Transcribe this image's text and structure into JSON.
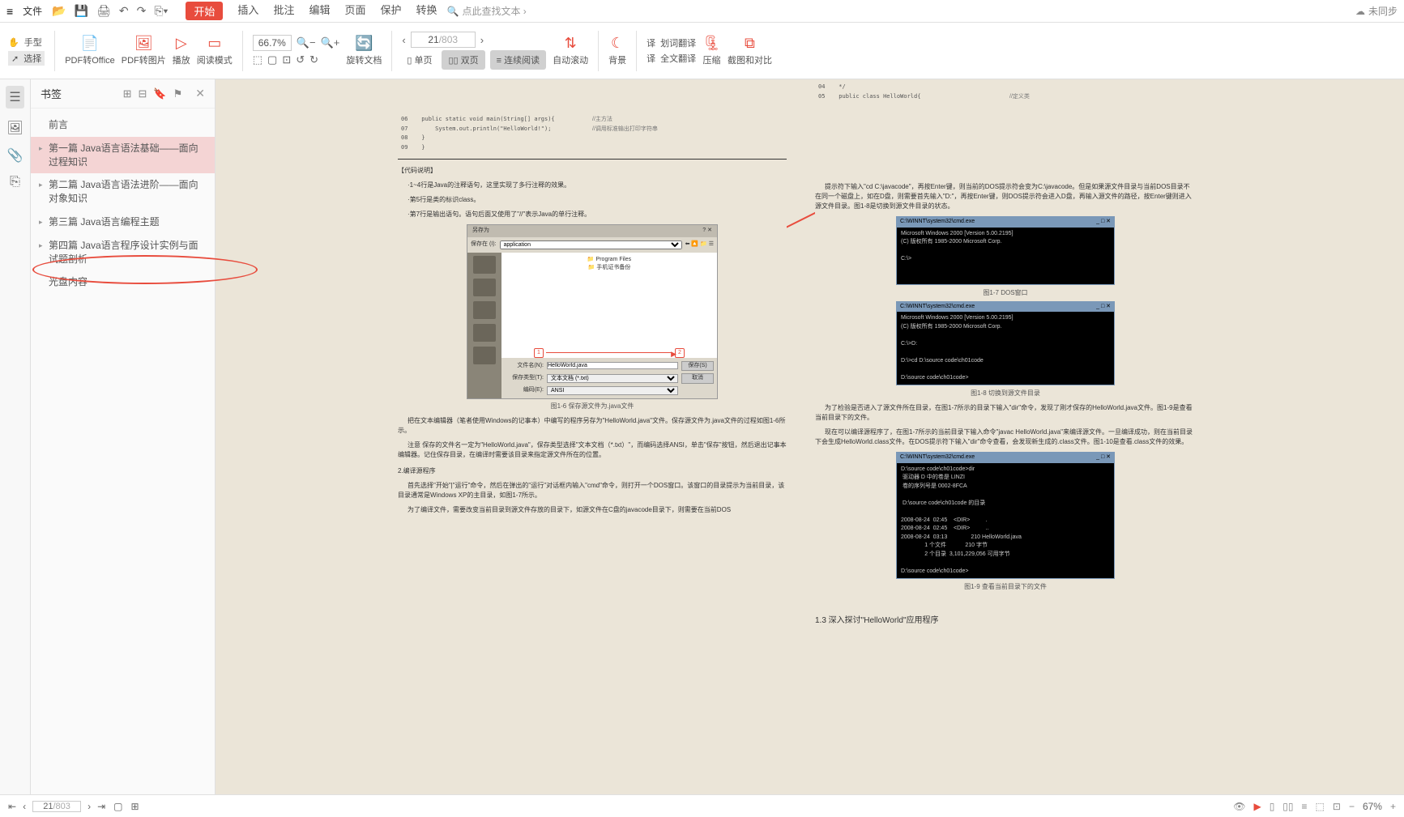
{
  "titlebar": {
    "file": "文件",
    "tabs": [
      "开始",
      "插入",
      "批注",
      "编辑",
      "页面",
      "保护",
      "转换"
    ],
    "active_tab": "开始",
    "search_placeholder": "点此查找文本 ›",
    "sync": "未同步"
  },
  "ribbon": {
    "hand": "手型",
    "select": "选择",
    "pdf_office": "PDF转Office",
    "pdf_image": "PDF转图片",
    "play": "播放",
    "read_mode": "阅读模式",
    "zoom": "66.7%",
    "rotate": "旋转文档",
    "page_current": "21",
    "page_total": "/803",
    "single": "单页",
    "double": "双页",
    "continuous": "连续阅读",
    "auto_scroll": "自动滚动",
    "background": "背景",
    "trans_sel": "划词翻译",
    "trans_full": "全文翻译",
    "compress": "压缩",
    "screenshot": "截图和对比"
  },
  "sidebar": {
    "title": "书签",
    "bookmarks": [
      {
        "label": "前言",
        "expandable": false
      },
      {
        "label": "第一篇 Java语言语法基础——面向过程知识",
        "expandable": true,
        "selected": true
      },
      {
        "label": "第二篇 Java语言语法进阶——面向对象知识",
        "expandable": true
      },
      {
        "label": "第三篇 Java语言编程主题",
        "expandable": true
      },
      {
        "label": "第四篇 Java语言程序设计实例与面试题剖析",
        "expandable": true
      },
      {
        "label": "光盘内容",
        "expandable": false
      }
    ]
  },
  "doc": {
    "left": {
      "code_lines": [
        {
          "n": "06",
          "t": "public static void main(String[] args){",
          "c": "//主方法"
        },
        {
          "n": "07",
          "t": "    System.out.println(\"HelloWorld!\");",
          "c": "//调用标准输出打印字符串"
        },
        {
          "n": "08",
          "t": "}",
          "c": ""
        },
        {
          "n": "09",
          "t": "}",
          "c": ""
        }
      ],
      "section": "【代码说明】",
      "p1": "·1~4行是Java的注释语句，这里实现了多行注释的效果。",
      "p2": "·第5行是类的标识class。",
      "p3": "·第7行是输出语句。语句后面又使用了\"//\"表示Java的单行注释。",
      "dialog": {
        "title": "另存为",
        "save_in": "保存在 (I):",
        "folder": "application",
        "list": [
          "Program Files",
          "手机证书备份"
        ],
        "filename_l": "文件名(N):",
        "filename": "HelloWorld.java",
        "filetype_l": "保存类型(T):",
        "filetype": "文本文档 (*.txt)",
        "encoding_l": "编码(E):",
        "encoding": "ANSI",
        "save": "保存(S)",
        "cancel": "取消"
      },
      "fig16": "图1-6  保存源文件为.java文件",
      "p4": "把在文本编辑器（笔者使用Windows的记事本）中编写的程序另存为\"HelloWorld.java\"文件。保存源文件为.java文件的过程如图1-6所示。",
      "p5": "注意  保存的文件名一定为\"HelloWorld.java\"，保存类型选择\"文本文档（*.txt）\"，而编码选择ANSI，单击\"保存\"按钮，然后退出记事本编辑器。记住保存目录，在编译时需要该目录来指定源文件所在的位置。",
      "h2": "2.编译源程序",
      "p6": "首先选择\"开始\"|\"运行\"命令，然后在弹出的\"运行\"对话框内输入\"cmd\"命令，则打开一个DOS窗口。该窗口的目录提示为当前目录，该目录通常是Windows XP的主目录，如图1-7所示。",
      "p7": "为了编译文件，需要改变当前目录到源文件存放的目录下，如源文件在C盘的javacode目录下，则需要在当前DOS"
    },
    "right": {
      "code_lines": [
        {
          "n": "04",
          "t": "*/",
          "c": ""
        },
        {
          "n": "05",
          "t": "public class HelloWorld{",
          "c": "//定义类"
        }
      ],
      "p1": "提示符下输入\"cd C:\\javacode\"，再按Enter键，则当前的DOS提示符会变为C:\\javacode。但是如果源文件目录与当前DOS目录不在同一个磁盘上，如在D盘，则需要首先输入\"D:\"，再按Enter键，则DOS提示符会进入D盘，再输入源文件的路径，按Enter键则进入源文件目录。图1-8是切换到源文件目录的状态。",
      "cmd1": {
        "title": "C:\\WINNT\\system32\\cmd.exe",
        "body": "Microsoft Windows 2000 [Version 5.00.2195]\n(C) 版权所有 1985-2000 Microsoft Corp.\n\nC:\\>"
      },
      "fig17": "图1-7  DOS窗口",
      "cmd2": {
        "title": "C:\\WINNT\\system32\\cmd.exe",
        "body": "Microsoft Windows 2000 [Version 5.00.2195]\n(C) 版权所有 1985-2000 Microsoft Corp.\n\nC:\\>D:\n\nD:\\>cd D:\\source code\\ch01code\n\nD:\\source code\\ch01code>"
      },
      "fig18": "图1-8  切换到源文件目录",
      "p2": "为了检验是否进入了源文件所在目录，在图1-7所示的目录下输入\"dir\"命令，发现了刚才保存的HelloWorld.java文件。图1-9是查看当前目录下的文件。",
      "p3": "现在可以编译源程序了，在图1-7所示的当前目录下输入命令\"javac HelloWorld.java\"来编译源文件。一旦编译成功，则在当前目录下会生成HelloWorld.class文件。在DOS提示符下输入\"dir\"命令查看，会发现新生成的.class文件。图1-10是查看.class文件的效果。",
      "cmd3": {
        "title": "C:\\WINNT\\system32\\cmd.exe",
        "body": "D:\\source code\\ch01code>dir\n 驱动器 D 中的卷是 LINZI\n 卷的序列号是 0002-8FCA\n\n D:\\source code\\ch01code 的目录\n\n2008-08-24  02:45    <DIR>          .\n2008-08-24  02:45    <DIR>          ..\n2008-08-24  03:13               210 HelloWorld.java\n               1 个文件            210 字节\n               2 个目录  3,101,229,056 可用字节\n\nD:\\source code\\ch01code>"
      },
      "fig19": "图1-9  查看当前目录下的文件",
      "h13": "1.3  深入探讨\"HelloWorld\"应用程序"
    }
  },
  "statusbar": {
    "page_current": "21",
    "page_total": "/803",
    "zoom": "67%"
  }
}
